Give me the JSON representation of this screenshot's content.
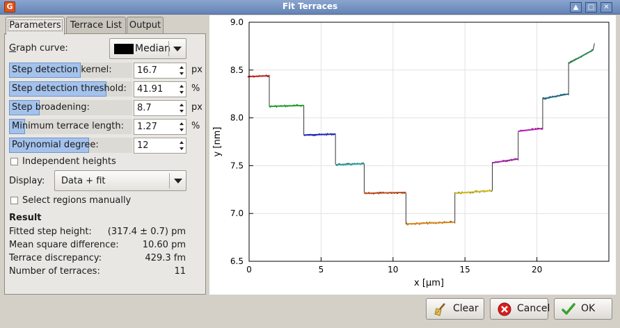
{
  "window": {
    "title": "Fit Terraces"
  },
  "tabs": [
    {
      "label": "Parameters",
      "active": true
    },
    {
      "label": "Terrace List",
      "active": false
    },
    {
      "label": "Output",
      "active": false
    }
  ],
  "params": {
    "graph_curve_label": "Graph curve:",
    "graph_curve_value": "Median",
    "rows": [
      {
        "label": "Step detection kernel:",
        "value": "16.7",
        "unit": "px",
        "fill": 0.58
      },
      {
        "label": "Step detection threshold:",
        "value": "41.91",
        "unit": "%",
        "fill": 0.79
      },
      {
        "label": "Step broadening:",
        "value": "8.7",
        "unit": "px",
        "fill": 0.25
      },
      {
        "label": "Minimum terrace length:",
        "value": "1.27",
        "unit": "%",
        "fill": 0.13
      },
      {
        "label": "Polynomial degree:",
        "value": "12",
        "unit": "",
        "fill": 0.65
      }
    ],
    "independent_heights_label": "Independent heights",
    "independent_heights_checked": false,
    "display_label": "Display:",
    "display_value": "Data + fit",
    "select_regions_label": "Select regions manually",
    "select_regions_checked": false
  },
  "result": {
    "heading": "Result",
    "items": [
      {
        "label": "Fitted step height:",
        "value": "(317.4 ± 0.7) pm"
      },
      {
        "label": "Mean square difference:",
        "value": "10.60 pm"
      },
      {
        "label": "Terrace discrepancy:",
        "value": "429.3 fm"
      },
      {
        "label": "Number of terraces:",
        "value": "11"
      }
    ]
  },
  "buttons": {
    "clear": "Clear",
    "cancel": "Cancel",
    "ok": "OK"
  },
  "chart_data": {
    "type": "line",
    "xlabel": "x [µm]",
    "ylabel": "y [nm]",
    "xlim": [
      0,
      25
    ],
    "ylim": [
      6.5,
      9.0
    ],
    "xticks": [
      0,
      5,
      10,
      15,
      20
    ],
    "yticks": [
      6.5,
      7.0,
      7.5,
      8.0,
      8.5,
      9.0
    ],
    "xtick_labels": [
      "0",
      "5",
      "10",
      "15",
      "20"
    ],
    "ytick_labels": [
      "6.5",
      "7.0",
      "7.5",
      "8.0",
      "8.5",
      "9.0"
    ],
    "grid": true,
    "series": [
      {
        "x": [
          -0.1,
          1.4
        ],
        "y": [
          8.43,
          8.44
        ],
        "color": "#d11f1f"
      },
      {
        "x": [
          1.4,
          3.8
        ],
        "y": [
          8.12,
          8.13
        ],
        "color": "#1faa1f"
      },
      {
        "x": [
          3.8,
          6.0
        ],
        "y": [
          7.82,
          7.83
        ],
        "color": "#2222cc"
      },
      {
        "x": [
          6.0,
          8.0
        ],
        "y": [
          7.51,
          7.52
        ],
        "color": "#20a5a5"
      },
      {
        "x": [
          8.0,
          10.9
        ],
        "y": [
          7.21,
          7.22
        ],
        "color": "#c94a17"
      },
      {
        "x": [
          10.9,
          14.3
        ],
        "y": [
          6.89,
          6.91
        ],
        "color": "#e08a10"
      },
      {
        "x": [
          14.3,
          16.9
        ],
        "y": [
          7.21,
          7.24
        ],
        "color": "#d4c010"
      },
      {
        "x": [
          16.9,
          18.7
        ],
        "y": [
          7.53,
          7.57
        ],
        "color": "#b21cb2"
      },
      {
        "x": [
          18.7,
          20.4
        ],
        "y": [
          7.86,
          7.89
        ],
        "color": "#c21ac2"
      },
      {
        "x": [
          20.4,
          22.2
        ],
        "y": [
          8.2,
          8.25
        ],
        "color": "#1a6f8a"
      },
      {
        "x": [
          22.2,
          23.9
        ],
        "y": [
          8.57,
          8.71
        ],
        "color": "#2e8a55"
      }
    ],
    "step_x": [
      1.4,
      3.8,
      6.0,
      8.0,
      10.9,
      14.3,
      16.9,
      18.7,
      20.4,
      22.2
    ],
    "end_point": [
      24.0,
      8.78
    ]
  },
  "colors": {
    "curve_swatch": "#000000",
    "slider_fill": "#a4c2ec",
    "title_bar": "#7391c2",
    "cancel_icon": "#d81e1e",
    "ok_icon": "#3aa02e"
  },
  "icons": {
    "app": "gwyddion-app-icon",
    "clear": "broom-icon",
    "cancel": "cancel-icon",
    "ok": "checkmark-icon"
  }
}
